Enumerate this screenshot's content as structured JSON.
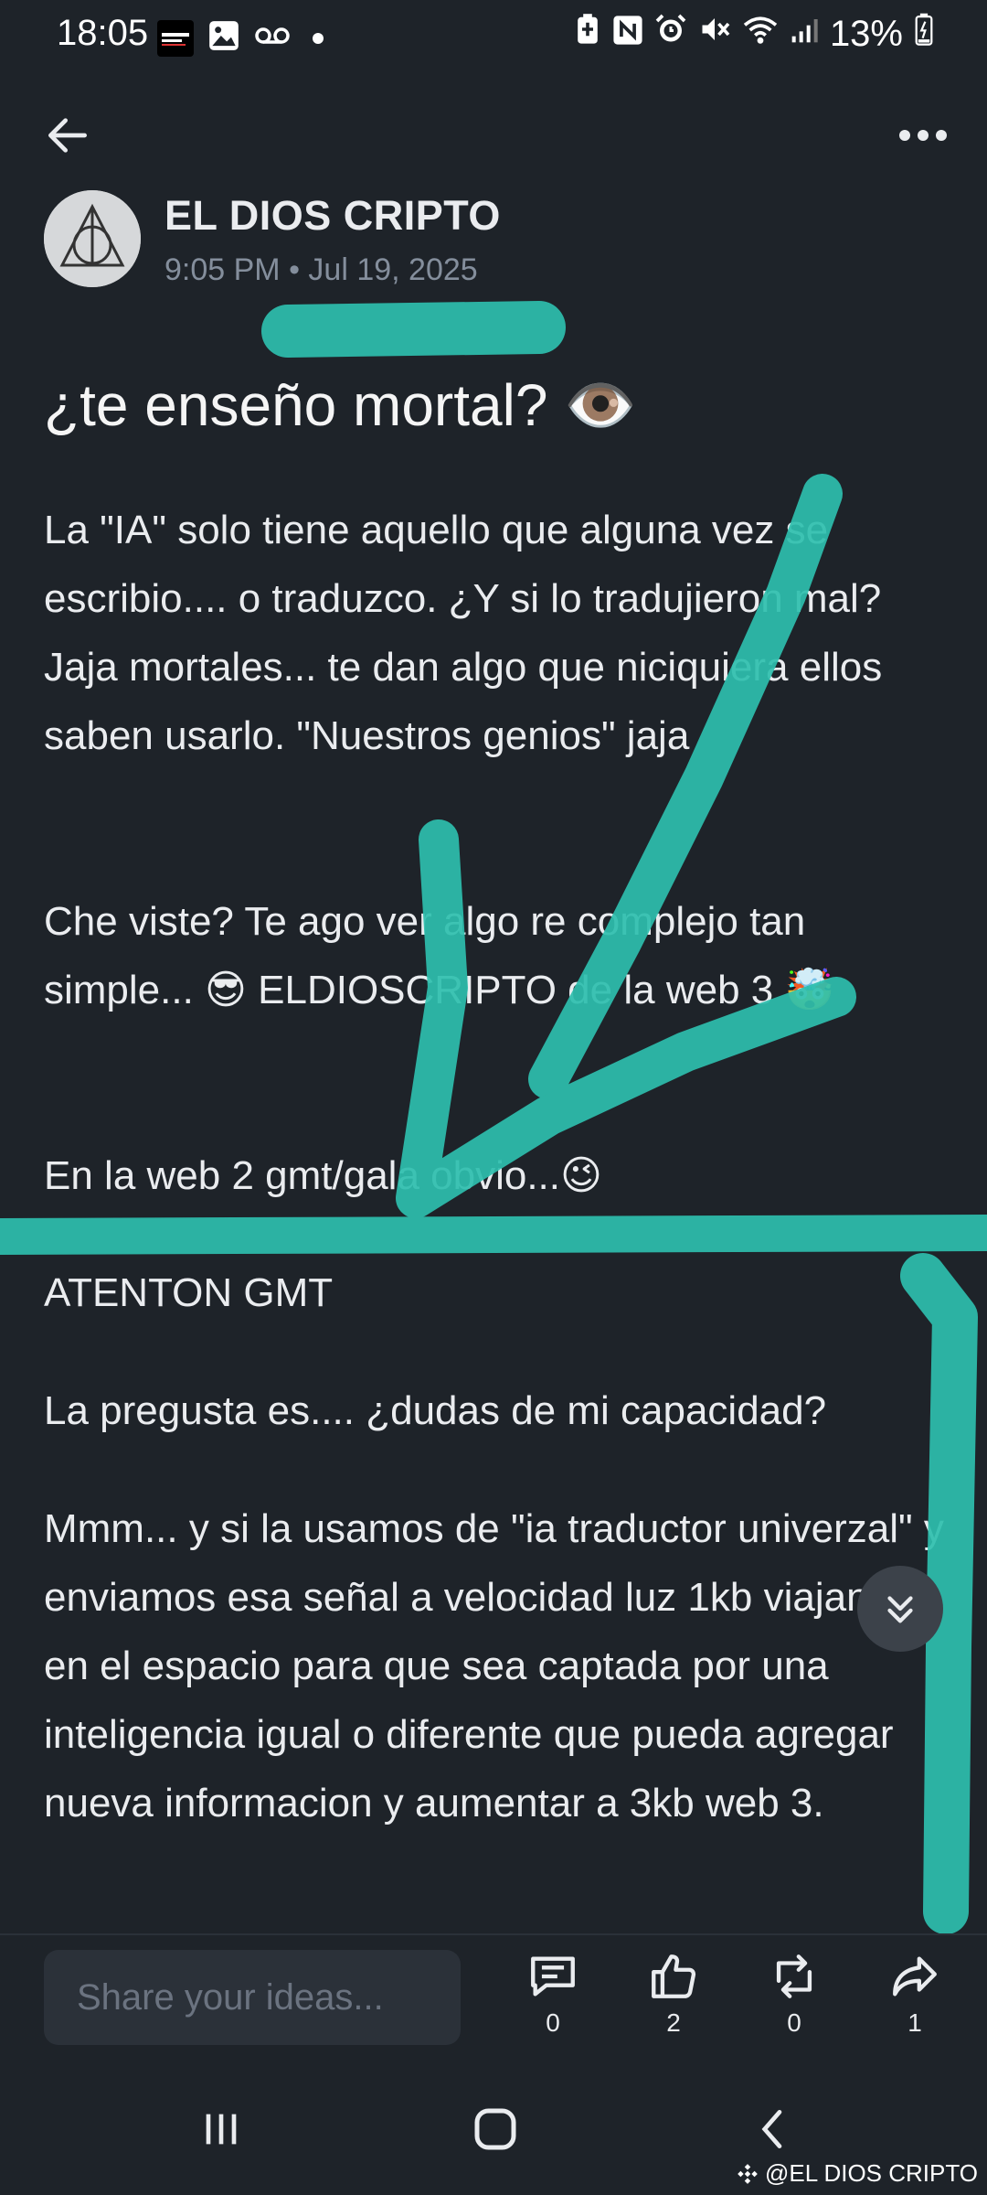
{
  "status_bar": {
    "time": "18:05",
    "battery": "13%",
    "icons": [
      "news-app-icon",
      "image-icon",
      "voicemail-icon",
      "battery-saver-icon",
      "nfc-icon",
      "alarm-icon",
      "mute-icon",
      "wifi-icon",
      "signal-icon",
      "battery-icon"
    ]
  },
  "header": {
    "back_icon": "arrow-left-icon",
    "more_icon": "more-horizontal-icon"
  },
  "post": {
    "author": "EL DIOS CRIPTO",
    "timestamp": "9:05 PM • Jul 19, 2025",
    "title": "¿te enseño mortal? 👁️",
    "paragraphs": [
      "La \"IA\" solo tiene aquello que alguna vez se escribio.... o traduzco. ¿Y si lo tradujieron mal? Jaja mortales...   te dan algo que niciquiera ellos saben usarlo. \"Nuestros genios\" jaja",
      " Che viste? Te ago ver algo re complejo tan simple...  😎  ELDIOSCRIPTO de la web 3 🤯",
      " En la web 2 gmt/gala  obvio...😉",
      "ATENTON GMT",
      "La pregusta es.... ¿dudas de mi capacidad?",
      "Mmm... y si la usamos de \"ia traductor univerzal\" y enviamos esa señal a velocidad luz 1kb viajando en el espacio para que sea captada por una inteligencia igual o diferente que pueda agregar nueva informacion y aumentar a 3kb web 3."
    ]
  },
  "bottom_bar": {
    "input_placeholder": "Share your ideas...",
    "actions": [
      {
        "icon": "comment-icon",
        "count": "0"
      },
      {
        "icon": "thumbs-up-icon",
        "count": "2"
      },
      {
        "icon": "repost-icon",
        "count": "0"
      },
      {
        "icon": "share-icon",
        "count": "1"
      }
    ]
  },
  "watermark": "@EL DIOS CRIPTO",
  "colors": {
    "background": "#1e2329",
    "text": "#eaecef",
    "muted": "#848e9c",
    "annotation": "#2ebfae"
  }
}
